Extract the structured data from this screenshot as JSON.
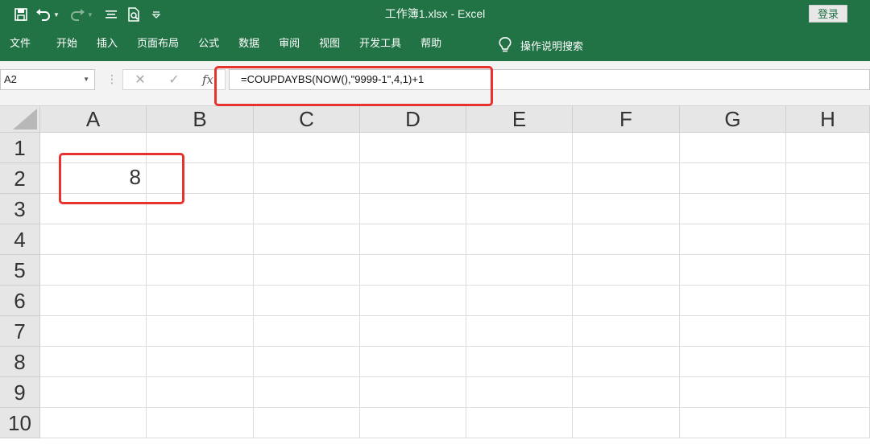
{
  "titlebar": {
    "title": "工作簿1.xlsx  -  Excel",
    "login_label": "登录",
    "accent": "#217346"
  },
  "qat": {
    "icons": [
      "save-icon",
      "undo-icon",
      "redo-icon",
      "align-icon",
      "print-preview-icon",
      "customize-icon"
    ]
  },
  "ribbon": {
    "tabs": [
      "文件",
      "开始",
      "插入",
      "页面布局",
      "公式",
      "数据",
      "审阅",
      "视图",
      "开发工具",
      "帮助"
    ],
    "tell_me": "操作说明搜索"
  },
  "formula_bar": {
    "name_box": "A2",
    "fx_label": "fx",
    "formula": "=COUPDAYBS(NOW(),\"9999-1\",4,1)+1",
    "highlight_color": "#e8322e"
  },
  "sheet": {
    "columns": [
      "A",
      "B",
      "C",
      "D",
      "E",
      "F",
      "G",
      "H"
    ],
    "rows": [
      "1",
      "2",
      "3",
      "4",
      "5",
      "6",
      "7",
      "8",
      "9",
      "10"
    ],
    "cells": {
      "A2": "8"
    }
  }
}
